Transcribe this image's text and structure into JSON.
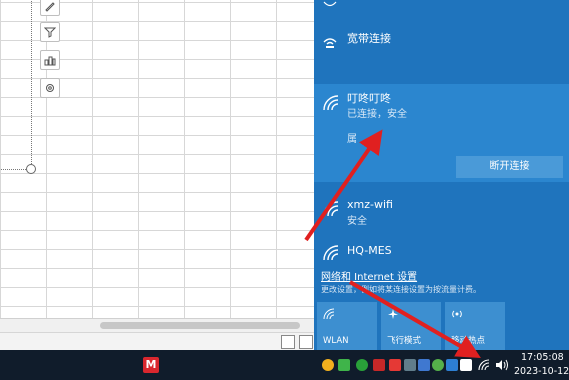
{
  "networks": [
    {
      "name": "宽带连接",
      "status": ""
    },
    {
      "name": "叮咚叮咚",
      "status": "已连接，安全",
      "extra": "属",
      "action": "断开连接"
    },
    {
      "name": "xmz-wifi",
      "status": "安全"
    },
    {
      "name": "HQ-MES",
      "status": ""
    }
  ],
  "settings": {
    "link": "网络和 Internet 设置",
    "desc": "更改设置，例如将某连接设置为按流量计费。"
  },
  "tiles": [
    {
      "label": "WLAN",
      "icon": "wifi-icon"
    },
    {
      "label": "飞行模式",
      "icon": "airplane-icon"
    },
    {
      "label": "移动热点",
      "icon": "hotspot-icon"
    }
  ],
  "clock": {
    "time": "17:05:08",
    "date": "2023-10-12"
  },
  "colors": {
    "flyout": "#1f74bd",
    "selected": "#2b86cf",
    "arrow": "#e02020",
    "taskbar": "#101c2b"
  }
}
